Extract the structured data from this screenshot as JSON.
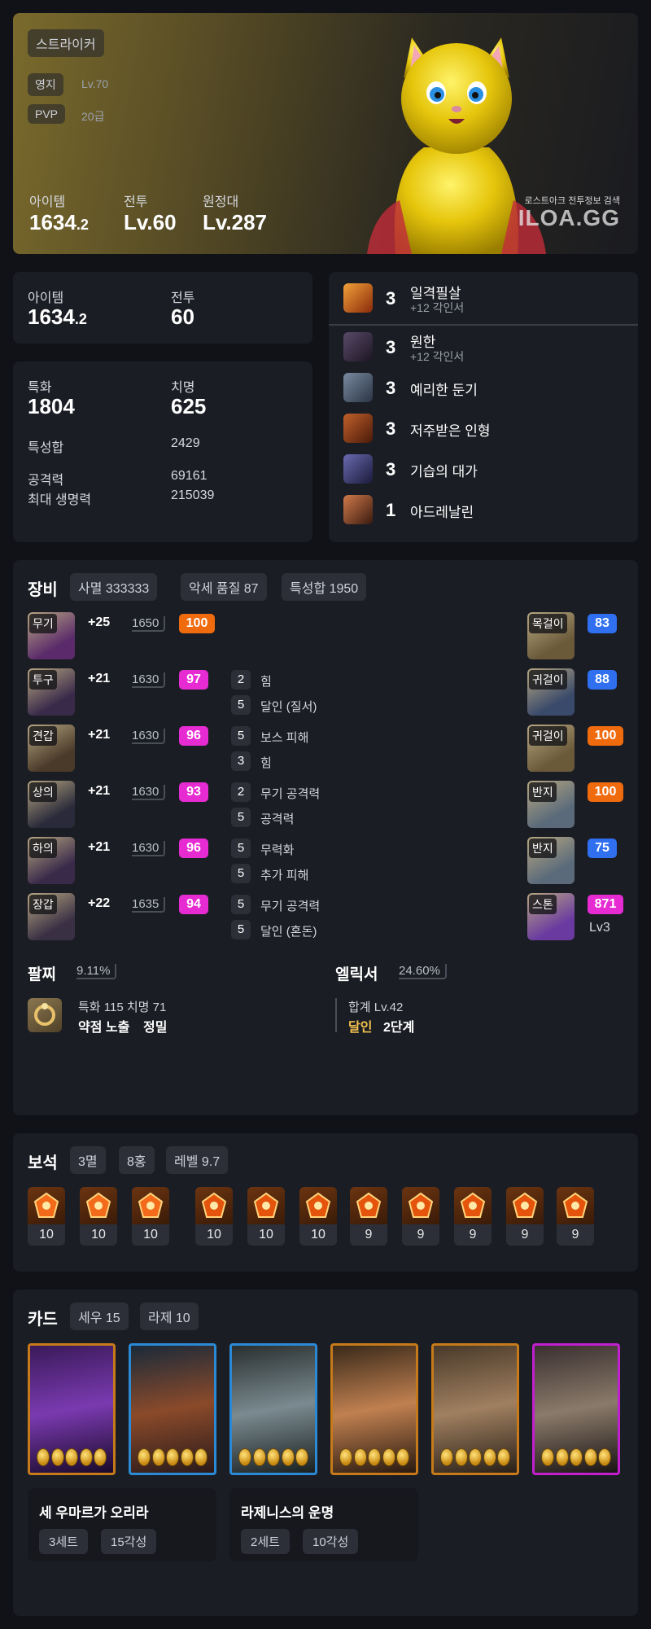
{
  "hero": {
    "class_name": "스트라이커",
    "estate_label": "영지",
    "estate_value": "Lv.70",
    "pvp_label": "PVP",
    "pvp_value": "20급",
    "item_label": "아이템",
    "item_int": "1634",
    "item_dec": ".2",
    "combat_label": "전투",
    "combat_value": "Lv.60",
    "expedition_label": "원정대",
    "expedition_value": "Lv.287",
    "watermark_small": "로스트아크 전투정보 검색",
    "watermark_big": "ILOA.GG"
  },
  "levels": {
    "item_label": "아이템",
    "item_int": "1634",
    "item_dec": ".2",
    "combat_label": "전투",
    "combat_value": "60"
  },
  "stats": {
    "crit_spec_label": "특화",
    "crit_spec_value": "1804",
    "crit_label": "치명",
    "crit_value": "625",
    "total_label": "특성합",
    "total_value": "2429",
    "attack_label": "공격력",
    "attack_value": "69161",
    "hp_label": "최대 생명력",
    "hp_value": "215039"
  },
  "engravings": [
    {
      "level": "3",
      "name": "일격필살",
      "sub": "+12 각인서",
      "icon": "fist-fire-icon"
    },
    {
      "level": "3",
      "name": "원한",
      "sub": "+12 각인서",
      "icon": "demon-icon"
    },
    {
      "level": "3",
      "name": "예리한 둔기",
      "sub": "",
      "icon": "blunt-weapon-icon"
    },
    {
      "level": "3",
      "name": "저주받은 인형",
      "sub": "",
      "icon": "cursed-doll-icon"
    },
    {
      "level": "3",
      "name": "기습의 대가",
      "sub": "",
      "icon": "ambush-icon"
    },
    {
      "level": "1",
      "name": "아드레날린",
      "sub": "",
      "icon": "adrenaline-icon"
    }
  ],
  "equipment": {
    "title": "장비",
    "chips": [
      "사멸 333333",
      "악세 품질 87",
      "특성합 1950"
    ],
    "armor": [
      {
        "slot": "무기",
        "enhance": "+25",
        "level": "1650",
        "quality": "100",
        "quality_color": "orange",
        "engravings": []
      },
      {
        "slot": "투구",
        "enhance": "+21",
        "level": "1630",
        "quality": "97",
        "quality_color": "pink",
        "engravings": [
          {
            "n": "2",
            "t": "힘"
          },
          {
            "n": "5",
            "t": "달인 (질서)"
          }
        ]
      },
      {
        "slot": "견갑",
        "enhance": "+21",
        "level": "1630",
        "quality": "96",
        "quality_color": "pink",
        "engravings": [
          {
            "n": "5",
            "t": "보스 피해"
          },
          {
            "n": "3",
            "t": "힘"
          }
        ]
      },
      {
        "slot": "상의",
        "enhance": "+21",
        "level": "1630",
        "quality": "93",
        "quality_color": "pink",
        "engravings": [
          {
            "n": "2",
            "t": "무기 공격력"
          },
          {
            "n": "5",
            "t": "공격력"
          }
        ]
      },
      {
        "slot": "하의",
        "enhance": "+21",
        "level": "1630",
        "quality": "96",
        "quality_color": "pink",
        "engravings": [
          {
            "n": "5",
            "t": "무력화"
          },
          {
            "n": "5",
            "t": "추가 피해"
          }
        ]
      },
      {
        "slot": "장갑",
        "enhance": "+22",
        "level": "1635",
        "quality": "94",
        "quality_color": "pink",
        "engravings": [
          {
            "n": "5",
            "t": "무기 공격력"
          },
          {
            "n": "5",
            "t": "달인 (혼돈)"
          }
        ]
      }
    ],
    "accessories": [
      {
        "slot": "목걸이",
        "quality": "83",
        "quality_color": "blue"
      },
      {
        "slot": "귀걸이",
        "quality": "88",
        "quality_color": "blue"
      },
      {
        "slot": "귀걸이",
        "quality": "100",
        "quality_color": "orange"
      },
      {
        "slot": "반지",
        "quality": "100",
        "quality_color": "orange"
      },
      {
        "slot": "반지",
        "quality": "75",
        "quality_color": "blue"
      },
      {
        "slot": "스톤",
        "quality": "871",
        "quality_color": "pink",
        "extra": "Lv3"
      }
    ],
    "bracelet_label": "팔찌",
    "bracelet_pct": "9.11%",
    "bracelet_stats": "특화 115   치명 71",
    "bracelet_effect1": "약점 노출",
    "bracelet_effect2": "정밀",
    "elixir_label": "엘릭서",
    "elixir_pct": "24.60%",
    "elixir_total": "합계 Lv.42",
    "elixir_effect_name": "달인",
    "elixir_effect_stage": "2단계"
  },
  "gems": {
    "title": "보석",
    "chips": [
      "3멸",
      "8홍",
      "레벨 9.7"
    ],
    "items": [
      {
        "value": "10",
        "type": "annihilation"
      },
      {
        "value": "10",
        "type": "annihilation"
      },
      {
        "value": "10",
        "type": "annihilation"
      },
      {
        "value": "10",
        "type": "crimson"
      },
      {
        "value": "10",
        "type": "crimson"
      },
      {
        "value": "10",
        "type": "crimson"
      },
      {
        "value": "9",
        "type": "crimson"
      },
      {
        "value": "9",
        "type": "crimson"
      },
      {
        "value": "9",
        "type": "crimson"
      },
      {
        "value": "9",
        "type": "crimson"
      },
      {
        "value": "9",
        "type": "crimson"
      }
    ]
  },
  "cards": {
    "title": "카드",
    "chips": [
      "세우 15",
      "라제 10"
    ],
    "items": [
      {
        "name": "dragon-card",
        "border": "#c77a1a"
      },
      {
        "name": "assassin-card",
        "border": "#2b8ad6"
      },
      {
        "name": "golem-card",
        "border": "#2b8ad6"
      },
      {
        "name": "dwarf-card",
        "border": "#c77a1a"
      },
      {
        "name": "lady-card",
        "border": "#c77a1a"
      },
      {
        "name": "wizard-card",
        "border": "#c21fcf"
      }
    ],
    "sets": [
      {
        "name": "세 우마르가 오리라",
        "set": "3세트",
        "awaken": "15각성"
      },
      {
        "name": "라제니스의 운명",
        "set": "2세트",
        "awaken": "10각성"
      }
    ]
  },
  "colors": {
    "orange": "#f06a0e",
    "pink": "#e72bd2",
    "blue": "#2f6ff0",
    "gold_text": "#f2c14e"
  }
}
